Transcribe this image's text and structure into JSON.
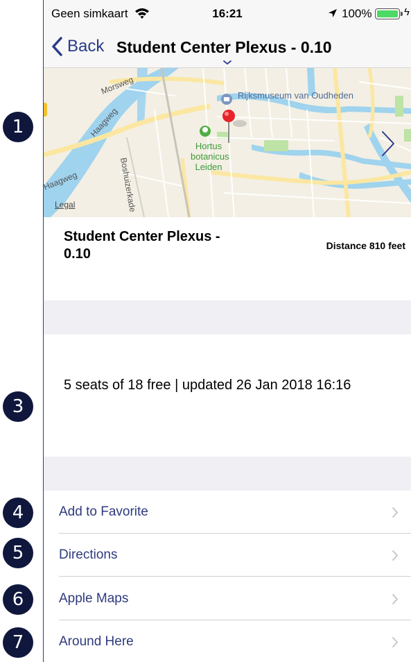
{
  "annotations": [
    "1",
    "3",
    "4",
    "5",
    "6",
    "7"
  ],
  "status_bar": {
    "carrier": "Geen simkaart",
    "time": "16:21",
    "battery_percent": "100%",
    "battery_level": 1.0
  },
  "nav": {
    "back_label": "Back",
    "title": "Student Center Plexus - 0.10"
  },
  "map": {
    "labels": {
      "museum": "Rijksmuseum van Oudheden",
      "hortus": "Hortus botanicus Leiden",
      "morsweg": "Morsweg",
      "haagweg_1": "Haagweg",
      "haagweg_2": "Haagweg",
      "boshuizerkade": "Boshuizerkade",
      "legal": "Legal"
    }
  },
  "place": {
    "name": "Student Center Plexus - 0.10",
    "distance": "Distance 810 feet"
  },
  "seats_text": "5 seats of 18 free | updated 26 Jan 2018 16:16",
  "actions": [
    {
      "label": "Add to Favorite"
    },
    {
      "label": "Directions"
    },
    {
      "label": "Apple Maps"
    },
    {
      "label": "Around Here"
    }
  ],
  "colors": {
    "accent": "#2e3a7e",
    "callout": "#10173d",
    "water": "#9fd3ee",
    "park": "#bde3a6",
    "road_major": "#fbe7a1",
    "pin": "#e8232a"
  }
}
